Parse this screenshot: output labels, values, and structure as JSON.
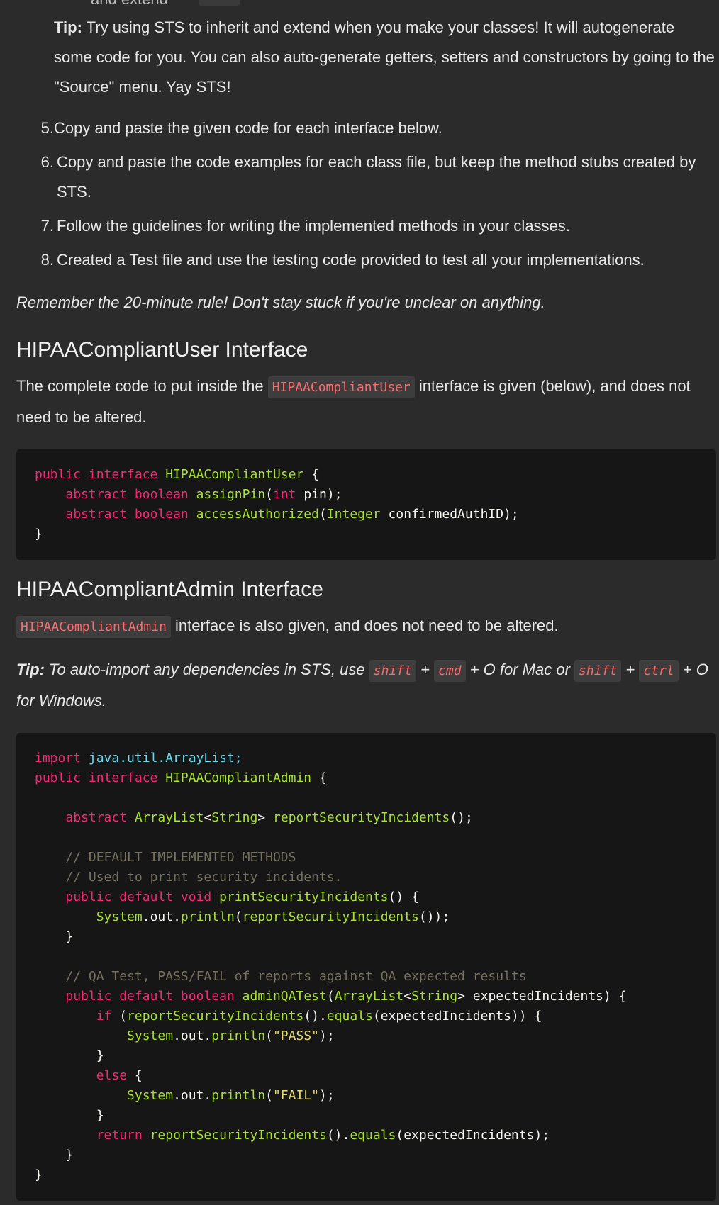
{
  "cut_line": "and extend",
  "tip_label": "Tip:",
  "tip_text": "Try using STS to inherit and extend when you make your classes! It will autogenerate some code for you. You can also auto-generate getters, setters and constructors by going to the \"Source\" menu. Yay STS!",
  "steps": [
    {
      "n": "5.",
      "text": "Copy and paste the given code for each interface below."
    },
    {
      "n": "6.",
      "text": "Copy and paste the code examples for each class file, but keep the method stubs created by STS."
    },
    {
      "n": "7.",
      "text": "Follow the guidelines for writing the implemented methods in your classes."
    },
    {
      "n": "8.",
      "text": "Created a Test file and use the testing code provided to test all your implementations."
    }
  ],
  "remember": "Remember the 20-minute rule! Don't stay stuck if you're unclear on anything.",
  "user_section": {
    "heading": "HIPAACompliantUser Interface",
    "intro_pre": "The complete code to put inside the",
    "intro_code": "HIPAACompliantUser",
    "intro_post": "interface is given (below), and does not need to be altered.",
    "code": [
      "public interface HIPAACompliantUser {",
      "    abstract boolean assignPin(int pin);",
      "    abstract boolean accessAuthorized(Integer confirmedAuthID);",
      "}"
    ]
  },
  "admin_section": {
    "heading": "HIPAACompliantAdmin Interface",
    "intro_code": "HIPAACompliantAdmin",
    "intro_post": "interface is also given, and does not need to be altered.",
    "tip_label": "Tip:",
    "tip_pre": "To auto-import any dependencies in STS, use",
    "k_shift": "shift",
    "plus": "+",
    "k_cmd": "cmd",
    "mid": "+ O for Mac or",
    "k_ctrl": "ctrl",
    "tip_post": "+ O for Windows.",
    "code": [
      "import java.util.ArrayList;",
      "public interface HIPAACompliantAdmin {",
      "",
      "    abstract ArrayList<String> reportSecurityIncidents();",
      "",
      "    // DEFAULT IMPLEMENTED METHODS",
      "    // Used to print security incidents.",
      "    public default void printSecurityIncidents() {",
      "        System.out.println(reportSecurityIncidents());",
      "    }",
      "",
      "    // QA Test, PASS/FAIL of reports against QA expected results",
      "    public default boolean adminQATest(ArrayList<String> expectedIncidents) {",
      "        if (reportSecurityIncidents().equals(expectedIncidents)) {",
      "            System.out.println(\"PASS\");",
      "        }",
      "        else {",
      "            System.out.println(\"FAIL\");",
      "        }",
      "        return reportSecurityIncidents().equals(expectedIncidents);",
      "    }",
      "}"
    ]
  }
}
